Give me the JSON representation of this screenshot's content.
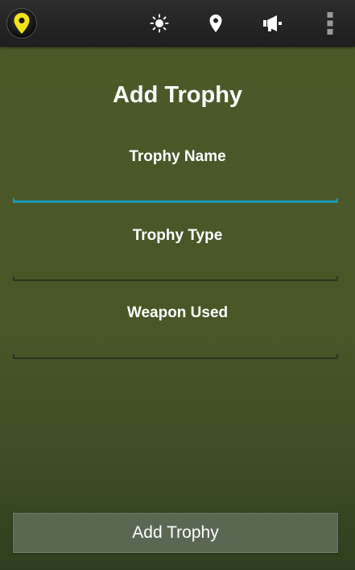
{
  "action_bar": {
    "icons": [
      "app-logo-pin-icon",
      "brightness-icon",
      "location-pin-icon",
      "megaphone-icon",
      "overflow-menu-icon"
    ]
  },
  "form": {
    "title": "Add Trophy",
    "fields": [
      {
        "label": "Trophy Name",
        "value": "",
        "focused": true
      },
      {
        "label": "Trophy Type",
        "value": "",
        "focused": false
      },
      {
        "label": "Weapon Used",
        "value": "",
        "focused": false
      }
    ],
    "submit_label": "Add Trophy"
  },
  "colors": {
    "background_top": "#4c5a2a",
    "background_bottom": "#2e3f1f",
    "focus_accent": "#1a9bb5",
    "button_bg": "#5a6853",
    "app_icon_pin": "#f2e31c"
  }
}
